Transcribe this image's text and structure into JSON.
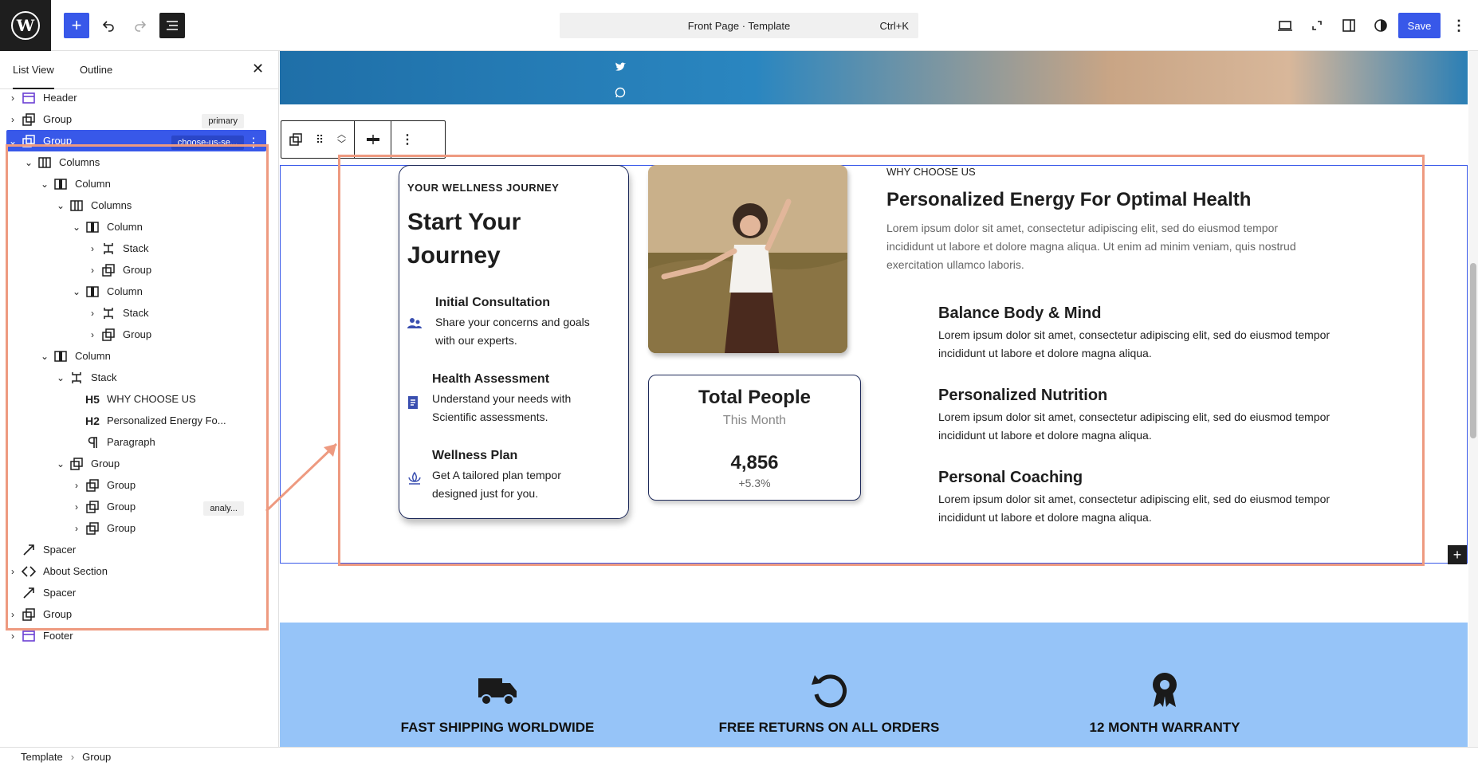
{
  "topbar": {
    "add_label": "+",
    "doc_title": "Front Page · Template",
    "doc_shortcut": "Ctrl+K",
    "save_label": "Save"
  },
  "sidebar": {
    "tabs": [
      "List View",
      "Outline"
    ],
    "close": "✕",
    "tree": [
      {
        "label": "Header",
        "icon": "template-part-icon",
        "level": 0,
        "chevron": "›"
      },
      {
        "label": "Group",
        "icon": "group-icon",
        "level": 0,
        "chevron": "›",
        "badge": "primary"
      },
      {
        "label": "Group",
        "icon": "group-icon",
        "level": 0,
        "chevron": "⌄",
        "badge": "choose-us-se...",
        "selected": true
      },
      {
        "label": "Columns",
        "icon": "columns-icon",
        "level": 1,
        "chevron": "⌄"
      },
      {
        "label": "Column",
        "icon": "column-icon",
        "level": 2,
        "chevron": "⌄"
      },
      {
        "label": "Columns",
        "icon": "columns-icon",
        "level": 3,
        "chevron": "⌄"
      },
      {
        "label": "Column",
        "icon": "column-icon",
        "level": 4,
        "chevron": "⌄"
      },
      {
        "label": "Stack",
        "icon": "stack-icon",
        "level": 5,
        "chevron": "›"
      },
      {
        "label": "Group",
        "icon": "group-icon",
        "level": 5,
        "chevron": "›"
      },
      {
        "label": "Column",
        "icon": "column-icon",
        "level": 4,
        "chevron": "⌄"
      },
      {
        "label": "Stack",
        "icon": "stack-icon",
        "level": 5,
        "chevron": "›"
      },
      {
        "label": "Group",
        "icon": "group-icon",
        "level": 5,
        "chevron": "›"
      },
      {
        "label": "Column",
        "icon": "column-icon",
        "level": 2,
        "chevron": "⌄"
      },
      {
        "label": "Stack",
        "icon": "stack-icon",
        "level": 3,
        "chevron": "⌄"
      },
      {
        "label": "WHY CHOOSE US",
        "icon": "H5",
        "level": 4,
        "chevron": ""
      },
      {
        "label": "Personalized Energy Fo...",
        "icon": "H2",
        "level": 4,
        "chevron": ""
      },
      {
        "label": "Paragraph",
        "icon": "paragraph-icon",
        "level": 4,
        "chevron": ""
      },
      {
        "label": "Group",
        "icon": "group-icon",
        "level": 3,
        "chevron": "⌄"
      },
      {
        "label": "Group",
        "icon": "group-icon",
        "level": 4,
        "chevron": "›"
      },
      {
        "label": "Group",
        "icon": "group-icon",
        "level": 4,
        "chevron": "›",
        "badge": "analy..."
      },
      {
        "label": "Group",
        "icon": "group-icon",
        "level": 4,
        "chevron": "›"
      },
      {
        "label": "Spacer",
        "icon": "spacer-icon",
        "level": 0,
        "chevron": ""
      },
      {
        "label": "About Section",
        "icon": "pattern-icon",
        "level": 0,
        "chevron": "›"
      },
      {
        "label": "Spacer",
        "icon": "spacer-icon",
        "level": 0,
        "chevron": ""
      },
      {
        "label": "Group",
        "icon": "group-icon",
        "level": 0,
        "chevron": "›"
      },
      {
        "label": "Footer",
        "icon": "template-part-icon",
        "level": 0,
        "chevron": "›"
      }
    ]
  },
  "breadcrumb": [
    "Template",
    "Group"
  ],
  "content": {
    "journey": {
      "kicker": "YOUR WELLNESS JOURNEY",
      "title": "Start Your Journey",
      "steps": [
        {
          "title": "Initial Consultation",
          "text": "Share your concerns and goals with our experts.",
          "icon": "people-icon"
        },
        {
          "title": "Health Assessment",
          "text": "Understand your needs with Scientific assessments.",
          "icon": "document-icon"
        },
        {
          "title": "Wellness Plan",
          "text": "Get A tailored plan tempor designed just for you.",
          "icon": "lotus-icon"
        }
      ]
    },
    "stat": {
      "title": "Total People",
      "subtitle": "This Month",
      "value": "4,856",
      "change": "+5.3%"
    },
    "why": {
      "kicker": "WHY CHOOSE US",
      "title": "Personalized Energy For Optimal Health",
      "paragraph": "Lorem ipsum dolor sit amet, consectetur adipiscing elit, sed do eiusmod tempor incididunt ut labore et dolore magna aliqua. Ut enim ad minim veniam, quis nostrud exercitation ullamco laboris.",
      "features": [
        {
          "title": "Balance Body & Mind",
          "text": "Lorem ipsum dolor sit amet, consectetur adipiscing elit, sed do eiusmod tempor incididunt ut labore et dolore magna aliqua."
        },
        {
          "title": "Personalized Nutrition",
          "text": "Lorem ipsum dolor sit amet, consectetur adipiscing elit, sed do eiusmod tempor incididunt ut labore et dolore magna aliqua."
        },
        {
          "title": "Personal Coaching",
          "text": "Lorem ipsum dolor sit amet, consectetur adipiscing elit, sed do eiusmod tempor incididunt ut labore et dolore magna aliqua."
        }
      ]
    },
    "band": [
      {
        "label": "FAST SHIPPING WORLDWIDE",
        "icon": "truck-icon"
      },
      {
        "label": "FREE RETURNS ON ALL ORDERS",
        "icon": "return-icon"
      },
      {
        "label": "12 MONTH WARRANTY",
        "icon": "award-icon"
      }
    ]
  },
  "colors": {
    "accent": "#3858e9",
    "highlight": "#ee9a80",
    "band": "#96c4f8"
  }
}
